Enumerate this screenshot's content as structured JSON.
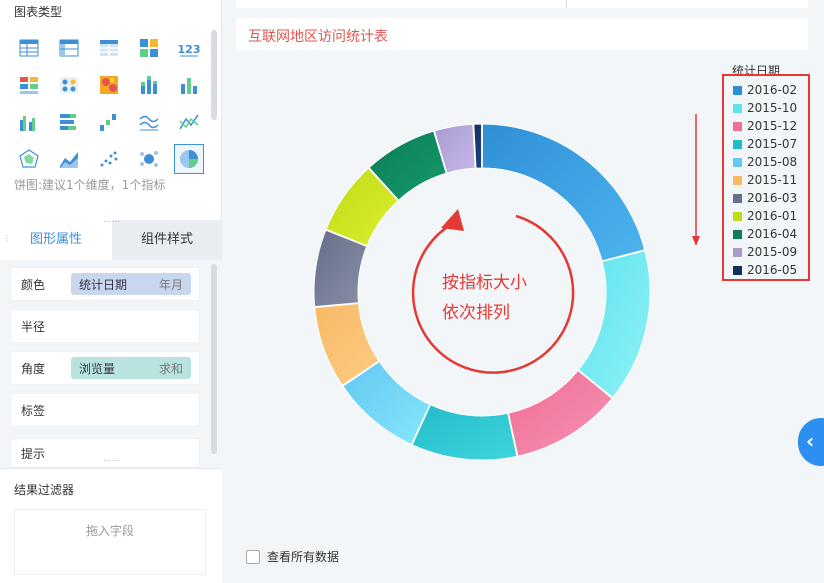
{
  "left_panel": {
    "chart_type_title": "图表类型",
    "chart_types": [
      {
        "icon": "table-icon"
      },
      {
        "icon": "cross-table-icon"
      },
      {
        "icon": "detail-table-icon"
      },
      {
        "icon": "color-block-icon"
      },
      {
        "icon": "number-kpi-icon"
      },
      {
        "icon": "text-kpi-icon"
      },
      {
        "icon": "dot-table-icon"
      },
      {
        "icon": "heatmap-icon"
      },
      {
        "icon": "stacked-bar-icon"
      },
      {
        "icon": "bar-chart-icon"
      },
      {
        "icon": "grouped-bar-icon"
      },
      {
        "icon": "horizontal-bar-icon"
      },
      {
        "icon": "waterfall-icon"
      },
      {
        "icon": "line-chart-icon"
      },
      {
        "icon": "line-compare-icon"
      },
      {
        "icon": "radar-icon"
      },
      {
        "icon": "area-chart-icon"
      },
      {
        "icon": "scatter-icon"
      },
      {
        "icon": "bubble-icon"
      },
      {
        "icon": "pie-chart-icon",
        "selected": true
      }
    ],
    "chart_hint": "饼图:建议1个维度，1个指标",
    "tabs": [
      {
        "label": "图形属性",
        "active": true
      },
      {
        "label": "组件样式",
        "active": false
      }
    ],
    "properties": [
      {
        "label": "颜色",
        "field": "统计日期",
        "agg": "年月",
        "style": "blue"
      },
      {
        "label": "半径"
      },
      {
        "label": "角度",
        "field": "浏览量",
        "agg": "求和",
        "style": "teal"
      },
      {
        "label": "标签"
      },
      {
        "label": "提示"
      }
    ],
    "filter_title": "结果过滤器",
    "filter_placeholder": "拖入字段"
  },
  "main": {
    "report_title": "互联网地区访问统计表",
    "annotation": [
      "按指标大小",
      "依次排列"
    ],
    "show_all_label": "查看所有数据",
    "collapse_glyph": "‹"
  },
  "colors": {
    "accent": "#3d8fd6",
    "title_red": "#e2564f",
    "annotation_red": "#e53935"
  },
  "chart_data": {
    "type": "pie",
    "subtype": "donut",
    "title": "",
    "legend_title": "统计日期",
    "legend_position": "right",
    "slices": [
      {
        "label": "2016-02",
        "value": 20.5,
        "color": "#2f8fd6",
        "color2": "#4db4ee"
      },
      {
        "label": "2015-10",
        "value": 14.5,
        "color": "#5fe3ee",
        "color2": "#8ff1f6"
      },
      {
        "label": "2015-12",
        "value": 10.5,
        "color": "#ef6f95",
        "color2": "#f592b3"
      },
      {
        "label": "2015-07",
        "value": 10.0,
        "color": "#22bcc8",
        "color2": "#3fd4dd"
      },
      {
        "label": "2015-08",
        "value": 8.5,
        "color": "#63c8f2",
        "color2": "#86e6fa"
      },
      {
        "label": "2015-11",
        "value": 7.8,
        "color": "#f8b964",
        "color2": "#fbcc85"
      },
      {
        "label": "2016-03",
        "value": 7.3,
        "color": "#676e8a",
        "color2": "#8a8fa6"
      },
      {
        "label": "2016-01",
        "value": 7.0,
        "color": "#bfda17",
        "color2": "#dcef2f"
      },
      {
        "label": "2016-04",
        "value": 7.0,
        "color": "#0c7d56",
        "color2": "#149a6b"
      },
      {
        "label": "2015-09",
        "value": 3.7,
        "color": "#a99ad2",
        "color2": "#c5b9e6"
      },
      {
        "label": "2016-05",
        "value": 0.8,
        "color": "#11305e",
        "color2": "#1b4580"
      }
    ]
  }
}
